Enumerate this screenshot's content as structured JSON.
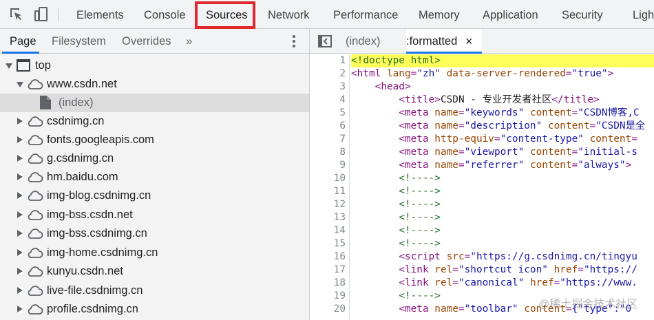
{
  "toolbar": {
    "tabs": [
      "Elements",
      "Console",
      "Sources",
      "Network",
      "Performance",
      "Memory",
      "Application",
      "Security",
      "Ligh"
    ],
    "selected_tab": "Sources",
    "highlight_color": "#e0282e"
  },
  "navigator": {
    "tabs": [
      "Page",
      "Filesystem",
      "Overrides"
    ],
    "active_tab": "Page",
    "more_label": "»",
    "tree": [
      {
        "label": "top",
        "icon": "frame-icon",
        "expanded": true,
        "depth": 0
      },
      {
        "label": "www.csdn.net",
        "icon": "cloud-icon",
        "expanded": true,
        "depth": 1
      },
      {
        "label": "(index)",
        "icon": "file-icon",
        "selected": true,
        "depth": 2
      },
      {
        "label": "csdnimg.cn",
        "icon": "cloud-icon",
        "expanded": false,
        "depth": 1
      },
      {
        "label": "fonts.googleapis.com",
        "icon": "cloud-icon",
        "expanded": false,
        "depth": 1
      },
      {
        "label": "g.csdnimg.cn",
        "icon": "cloud-icon",
        "expanded": false,
        "depth": 1
      },
      {
        "label": "hm.baidu.com",
        "icon": "cloud-icon",
        "expanded": false,
        "depth": 1
      },
      {
        "label": "img-blog.csdnimg.cn",
        "icon": "cloud-icon",
        "expanded": false,
        "depth": 1
      },
      {
        "label": "img-bss.csdn.net",
        "icon": "cloud-icon",
        "expanded": false,
        "depth": 1
      },
      {
        "label": "img-bss.csdnimg.cn",
        "icon": "cloud-icon",
        "expanded": false,
        "depth": 1
      },
      {
        "label": "img-home.csdnimg.cn",
        "icon": "cloud-icon",
        "expanded": false,
        "depth": 1
      },
      {
        "label": "kunyu.csdn.net",
        "icon": "cloud-icon",
        "expanded": false,
        "depth": 1
      },
      {
        "label": "live-file.csdnimg.cn",
        "icon": "cloud-icon",
        "expanded": false,
        "depth": 1
      },
      {
        "label": "profile.csdnimg.cn",
        "icon": "cloud-icon",
        "expanded": false,
        "depth": 1
      }
    ]
  },
  "editor": {
    "tabs": [
      "(index)",
      ":formatted"
    ],
    "active_tab": ":formatted",
    "close_label": "×",
    "highlighted_line": 1,
    "lines": [
      [
        [
          "t-cmt",
          "<!doctype html>"
        ]
      ],
      [
        [
          "t-tag",
          "<html "
        ],
        [
          "t-attr",
          "lang"
        ],
        [
          "t-tag",
          "="
        ],
        [
          "t-val",
          "\"zh\""
        ],
        [
          "t-tag",
          " "
        ],
        [
          "t-attr",
          "data-server-rendered"
        ],
        [
          "t-tag",
          "="
        ],
        [
          "t-val",
          "\"true\""
        ],
        [
          "t-tag",
          ">"
        ]
      ],
      [
        [
          "t-txt",
          "    "
        ],
        [
          "t-tag",
          "<head>"
        ]
      ],
      [
        [
          "t-txt",
          "        "
        ],
        [
          "t-tag",
          "<title>"
        ],
        [
          "t-txt",
          "CSDN - 专业开发者社区"
        ],
        [
          "t-tag",
          "</title>"
        ]
      ],
      [
        [
          "t-txt",
          "        "
        ],
        [
          "t-tag",
          "<meta "
        ],
        [
          "t-attr",
          "name"
        ],
        [
          "t-tag",
          "="
        ],
        [
          "t-val",
          "\"keywords\""
        ],
        [
          "t-tag",
          " "
        ],
        [
          "t-attr",
          "content"
        ],
        [
          "t-tag",
          "="
        ],
        [
          "t-val",
          "\"CSDN博客,C"
        ]
      ],
      [
        [
          "t-txt",
          "        "
        ],
        [
          "t-tag",
          "<meta "
        ],
        [
          "t-attr",
          "name"
        ],
        [
          "t-tag",
          "="
        ],
        [
          "t-val",
          "\"description\""
        ],
        [
          "t-tag",
          " "
        ],
        [
          "t-attr",
          "content"
        ],
        [
          "t-tag",
          "="
        ],
        [
          "t-val",
          "\"CSDN是全"
        ]
      ],
      [
        [
          "t-txt",
          "        "
        ],
        [
          "t-tag",
          "<meta "
        ],
        [
          "t-attr",
          "http-equiv"
        ],
        [
          "t-tag",
          "="
        ],
        [
          "t-val",
          "\"content-type\""
        ],
        [
          "t-tag",
          " "
        ],
        [
          "t-attr",
          "content"
        ],
        [
          "t-tag",
          "="
        ]
      ],
      [
        [
          "t-txt",
          "        "
        ],
        [
          "t-tag",
          "<meta "
        ],
        [
          "t-attr",
          "name"
        ],
        [
          "t-tag",
          "="
        ],
        [
          "t-val",
          "\"viewport\""
        ],
        [
          "t-tag",
          " "
        ],
        [
          "t-attr",
          "content"
        ],
        [
          "t-tag",
          "="
        ],
        [
          "t-val",
          "\"initial-s"
        ]
      ],
      [
        [
          "t-txt",
          "        "
        ],
        [
          "t-tag",
          "<meta "
        ],
        [
          "t-attr",
          "name"
        ],
        [
          "t-tag",
          "="
        ],
        [
          "t-val",
          "\"referrer\""
        ],
        [
          "t-tag",
          " "
        ],
        [
          "t-attr",
          "content"
        ],
        [
          "t-tag",
          "="
        ],
        [
          "t-val",
          "\"always\""
        ],
        [
          "t-tag",
          ">"
        ]
      ],
      [
        [
          "t-txt",
          "        "
        ],
        [
          "t-cmt",
          "<!---->"
        ]
      ],
      [
        [
          "t-txt",
          "        "
        ],
        [
          "t-cmt",
          "<!---->"
        ]
      ],
      [
        [
          "t-txt",
          "        "
        ],
        [
          "t-cmt",
          "<!---->"
        ]
      ],
      [
        [
          "t-txt",
          "        "
        ],
        [
          "t-cmt",
          "<!---->"
        ]
      ],
      [
        [
          "t-txt",
          "        "
        ],
        [
          "t-cmt",
          "<!---->"
        ]
      ],
      [
        [
          "t-txt",
          "        "
        ],
        [
          "t-cmt",
          "<!---->"
        ]
      ],
      [
        [
          "t-txt",
          "        "
        ],
        [
          "t-tag",
          "<script "
        ],
        [
          "t-attr",
          "src"
        ],
        [
          "t-tag",
          "="
        ],
        [
          "t-val",
          "\"https://g.csdnimg.cn/tingyu"
        ]
      ],
      [
        [
          "t-txt",
          "        "
        ],
        [
          "t-tag",
          "<link "
        ],
        [
          "t-attr",
          "rel"
        ],
        [
          "t-tag",
          "="
        ],
        [
          "t-val",
          "\"shortcut icon\""
        ],
        [
          "t-tag",
          " "
        ],
        [
          "t-attr",
          "href"
        ],
        [
          "t-tag",
          "="
        ],
        [
          "t-val",
          "\"https://"
        ]
      ],
      [
        [
          "t-txt",
          "        "
        ],
        [
          "t-tag",
          "<link "
        ],
        [
          "t-attr",
          "rel"
        ],
        [
          "t-tag",
          "="
        ],
        [
          "t-val",
          "\"canonical\""
        ],
        [
          "t-tag",
          " "
        ],
        [
          "t-attr",
          "href"
        ],
        [
          "t-tag",
          "="
        ],
        [
          "t-val",
          "\"https://www."
        ]
      ],
      [
        [
          "t-txt",
          "        "
        ],
        [
          "t-cmt",
          "<!---->"
        ]
      ],
      [
        [
          "t-txt",
          "        "
        ],
        [
          "t-tag",
          "<meta "
        ],
        [
          "t-attr",
          "name"
        ],
        [
          "t-tag",
          "="
        ],
        [
          "t-val",
          "\"toolbar\""
        ],
        [
          "t-tag",
          " "
        ],
        [
          "t-attr",
          "content"
        ],
        [
          "t-tag",
          "="
        ],
        [
          "t-val",
          "{\"type\":\"0"
        ]
      ]
    ]
  },
  "watermark": "@稀土掘金技术社区"
}
